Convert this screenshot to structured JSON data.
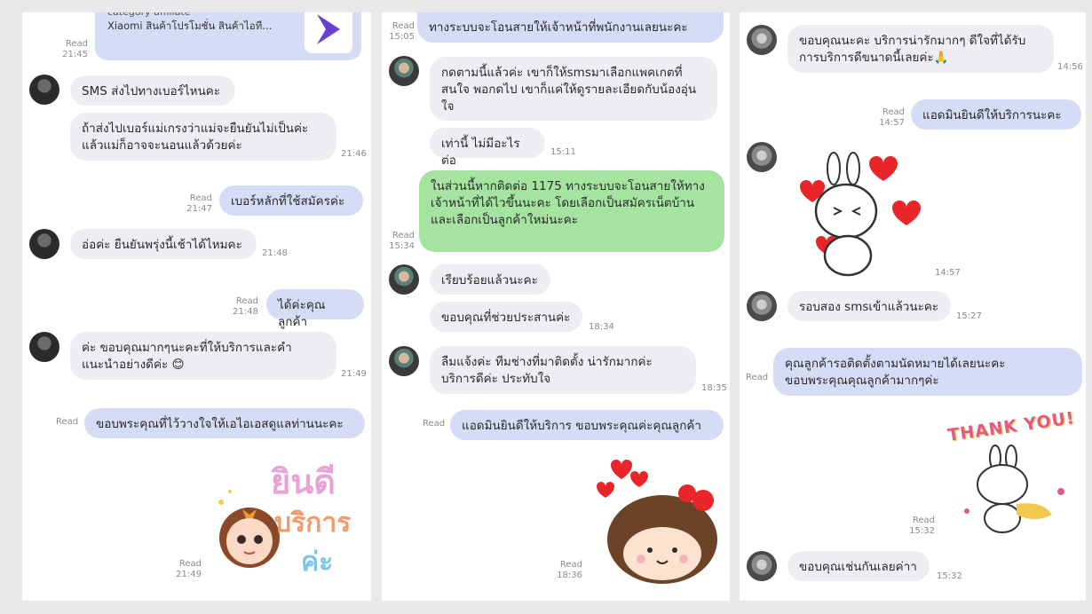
{
  "panel1": {
    "top_card": {
      "line1": "category affiliate",
      "line2": "Xiaomi สินค้าโปรโมชั่น สินค้าไอที...",
      "read": "Read",
      "time": "21:45"
    },
    "m1": {
      "text": "SMS ส่งไปทางเบอร์ไหนคะ"
    },
    "m2": {
      "text": "ถ้าส่งไปเบอร์แม่เกรงว่าแม่จะยืนยันไม่เป็นค่ะ แล้วแม่ก็อาจจะนอนแล้วด้วยค่ะ",
      "time": "21:46"
    },
    "m3": {
      "text": "เบอร์หลักที่ใช้สมัครค่ะ",
      "read": "Read",
      "time": "21:47"
    },
    "m4": {
      "text": "อ่อค่ะ ยืนยันพรุ่งนี้เช้าได้ไหมคะ",
      "time": "21:48"
    },
    "m5": {
      "text": "ได้ค่ะคุณลูกค้า",
      "read": "Read",
      "time": "21:48"
    },
    "m6": {
      "text": "ค่ะ ขอบคุณมากๆนะคะที่ให้บริการและคำแนะนำอย่างดีค่ะ 😊",
      "time": "21:49"
    },
    "m7": {
      "text": "ขอบพระคุณที่ไว้วางใจให้เอไอเอสดูแลท่านนะคะ",
      "read": "Read"
    },
    "sticker": {
      "text1": "ยินดี",
      "text2": "บริการ",
      "text3": "ค่ะ",
      "read": "Read",
      "time": "21:49"
    }
  },
  "panel2": {
    "m0": {
      "text": "ทางระบบจะโอนสายให้เจ้าหน้าที่พนักงานเลยนะคะ",
      "read": "Read",
      "time": "15:05"
    },
    "m1": {
      "text": "กดตามนี้แล้วค่ะ เขาก็ให้smsมาเลือกแพคเกตที่สนใจ พอกดไป เขาก็แค่ให้ดูรายละเอียดกับน้องอุ่นใจ"
    },
    "m2": {
      "text": "เท่านี้ ไม่มีอะไรต่อ",
      "time": "15:11"
    },
    "m3": {
      "text": "ในส่วนนี้หากติดต่อ 1175 ทางระบบจะโอนสายให้ทางเจ้าหน้าที่ได้ไวขึ้นนะคะ โดยเลือกเป็นสมัครเน็ตบ้าน และเลือกเป็นลูกค้าใหม่นะคะ",
      "read": "Read",
      "time": "15:34"
    },
    "m4": {
      "text": "เรียบร้อยแล้วนะคะ"
    },
    "m5": {
      "text": "ขอบคุณที่ช่วยประสานค่ะ",
      "time": "18:34"
    },
    "m6": {
      "text": "ลืมแจ้งค่ะ ทีมช่างที่มาติดตั้ง น่ารักมากค่ะ บริการดีค่ะ ประทับใจ",
      "time": "18:35"
    },
    "m7": {
      "text": "แอดมินยินดีให้บริการ ขอบพระคุณค่ะคุณลูกค้า",
      "read": "Read"
    },
    "sticker": {
      "read": "Read",
      "time": "18:36"
    }
  },
  "panel3": {
    "m1": {
      "text": "ขอบคุณนะคะ บริการน่ารักมากๆ ดีใจที่ได้รับการบริการดีขนาดนี้เลยค่ะ🙏",
      "time": "14:56"
    },
    "m2": {
      "text": "แอดมินยินดีให้บริการนะคะ",
      "read": "Read",
      "time": "14:57"
    },
    "sticker1": {
      "time": "14:57"
    },
    "m3": {
      "text": "รอบสอง smsเข้าแล้วนะคะ",
      "time": "15:27"
    },
    "m4": {
      "text": "คุณลูกค้ารอติดตั้งตามนัดหมายได้เลยนะคะ ขอบพระคุณคุณลูกค้ามากๆค่ะ",
      "read": "Read"
    },
    "sticker2": {
      "text": "THANK YOU!",
      "read": "Read",
      "time": "15:32"
    },
    "m5": {
      "text": "ขอบคุณเช่นกันเลยค่าา",
      "time": "15:32"
    }
  },
  "colors": {
    "incoming": "#eceef2",
    "outgoing": "#d6dcf6",
    "green": "#a5e3a0",
    "background": "#e9e9ec"
  }
}
